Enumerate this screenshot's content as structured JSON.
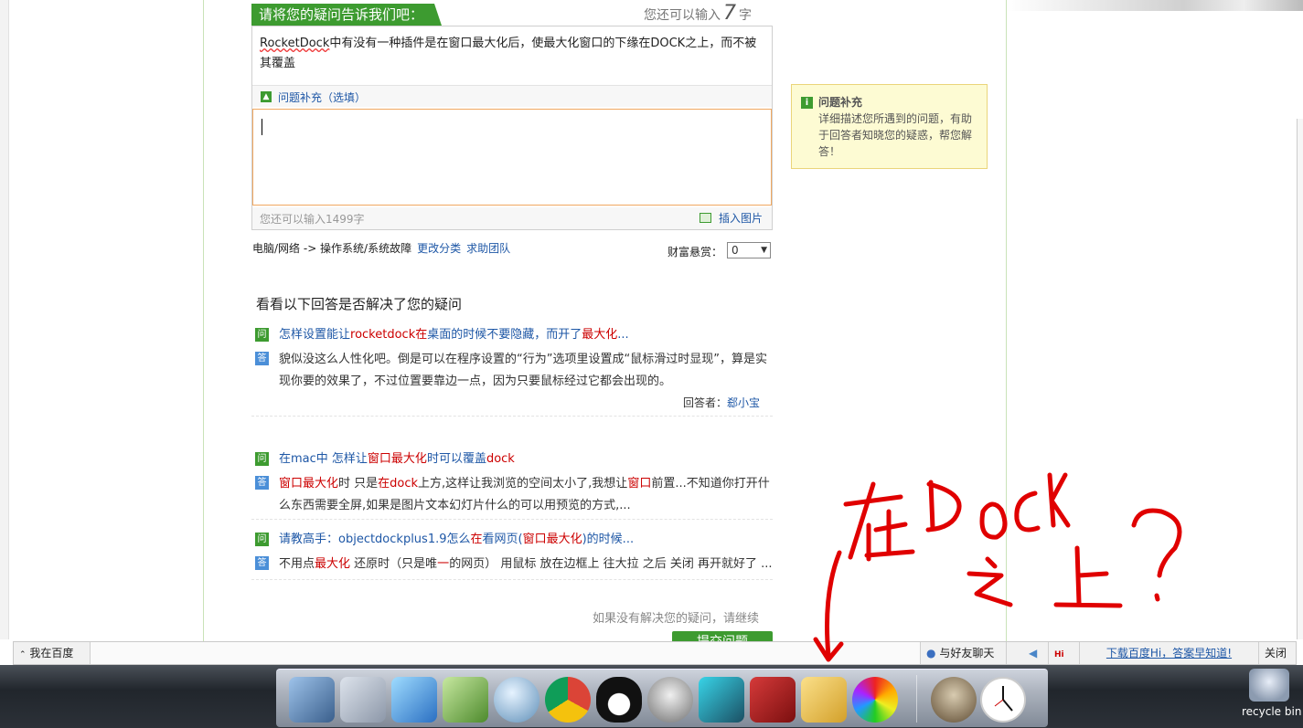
{
  "question_header": {
    "title": "请将您的疑问告诉我们吧：",
    "counter_prefix": "您还可以输入",
    "counter_num": "7",
    "counter_suffix": "字"
  },
  "question": {
    "brand": "RocketDock",
    "text": "中有没有一种插件是在窗口最大化后，使最大化窗口的下缘在DOCK之上，而不被其覆盖",
    "supplement_label": "问题补充（选填）",
    "remaining": "您还可以输入1499字",
    "insert_image": "插入图片"
  },
  "category": {
    "path": "电脑/网络 -> 操作系统/系统故障",
    "change_link": "更改分类",
    "help_team": "求助团队"
  },
  "reward": {
    "label": "财富悬赏：",
    "value": "0"
  },
  "tip": {
    "title": "问题补充",
    "body": "详细描述您所遇到的问题，有助于回答者知晓您的疑惑，帮您解答！"
  },
  "answers_title": "看看以下回答是否解决了您的疑问",
  "badges": {
    "q": "问",
    "a": "答"
  },
  "qa": [
    {
      "q": [
        "怎样设置能让",
        "rocketdock",
        "在",
        "桌面的时候不要隐藏，而开了",
        "最大化",
        "..."
      ],
      "a": [
        "貌似没这么人性化吧。倒是可以在程序设置的“行为”选项里设置成“鼠标滑过时显现”，算是实现你要的效果了，不过位置要靠边一点，因为只要鼠标经过它都会出现的。"
      ],
      "by_label": "回答者：",
      "by_name": "郄小宝"
    },
    {
      "q": [
        "在mac中 怎样让",
        "窗口最大化",
        "时可以覆盖",
        "dock",
        ""
      ],
      "a": [
        "窗口最大化",
        "时 只是",
        "在dock",
        "上方,这样让我浏览的空间太小了,我想让",
        "窗口",
        "前置...不知道你打开什么东西需要全屏,如果是图片文本幻灯片什么的可以用预览的方式,..."
      ]
    },
    {
      "q": [
        "请教高手：objectdockplus1.9怎么",
        "在",
        "看网页(",
        "窗口最大化",
        ")的时候..."
      ],
      "a": [
        "不用点",
        "最大化",
        " 还原时（只是唯",
        "一",
        "的网页） 用鼠标 放在边框上 往大拉 之后 关闭 再开就好了 ..."
      ]
    }
  ],
  "unsolved": "如果没有解决您的疑问，请继续",
  "submit": "提交问题",
  "toolbar": {
    "me": "我在百度",
    "chat": "与好友聊天",
    "hi": "Hi",
    "download": "下载百度Hi，答案早知道!",
    "close": "关闭"
  },
  "recycle": "recycle bin",
  "annotation_text": "在DOCK之上？",
  "colors": {
    "green": "#3d9b30",
    "link": "#1e57a6",
    "highlight": "#cc0000",
    "annotation": "#e00000"
  }
}
